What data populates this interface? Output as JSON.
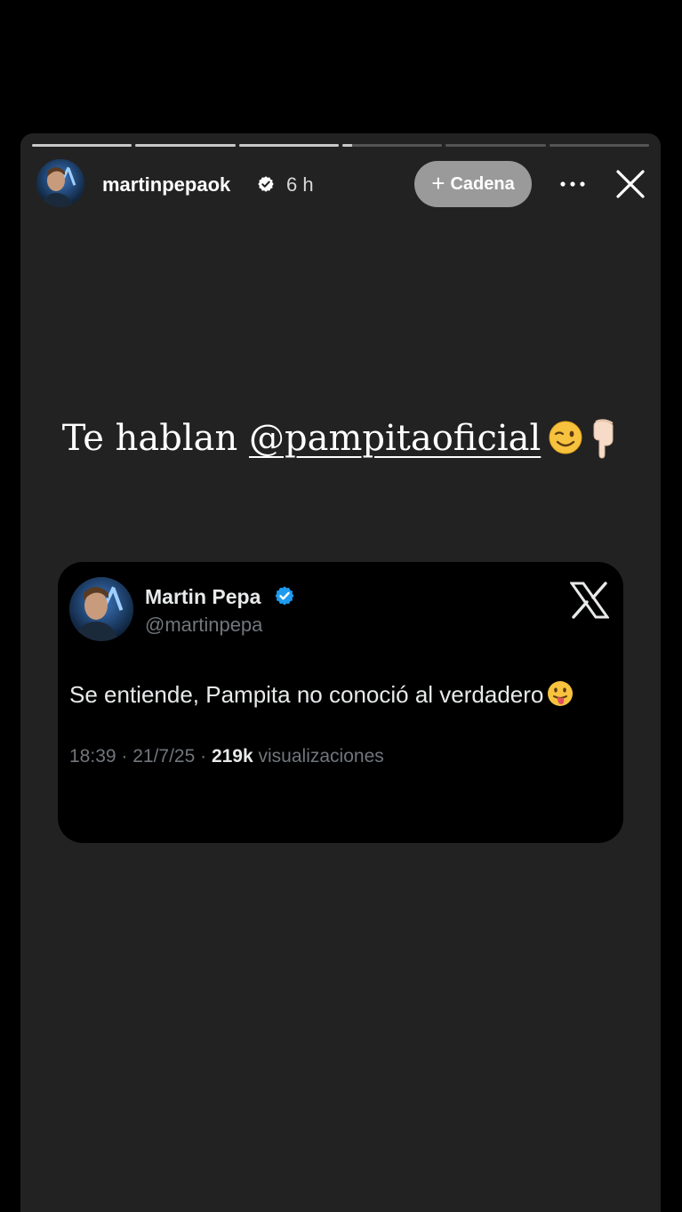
{
  "story": {
    "segments": [
      {
        "fill": 1.0
      },
      {
        "fill": 1.0
      },
      {
        "fill": 1.0
      },
      {
        "fill": 0.1
      },
      {
        "fill": 0.0
      },
      {
        "fill": 0.0
      }
    ],
    "header": {
      "username": "martinpepaok",
      "time": "6 h",
      "chain_button": {
        "icon": "+",
        "label": "Cadena"
      },
      "more_icon": "ellipsis-icon",
      "close_icon": "close-icon"
    },
    "caption": {
      "prefix": "Te hablan ",
      "mention": "@pampitaoficial",
      "emojis": [
        "winking-face-emoji",
        "pointing-down-emoji"
      ]
    },
    "tweet": {
      "name": "Martin Pepa",
      "handle": "@martinpepa",
      "text": "Se entiende, Pampita no conoció al verdadero",
      "emoji": "tongue-face-emoji",
      "time_date": "18:39 · 21/7/25 · ",
      "views_count": "219k",
      "views_label": " visualizaciones",
      "logo": "x-logo-icon"
    },
    "colors": {
      "story_bg": "#222222",
      "tweet_bg": "#000000",
      "verified_blue": "#1d9bf0",
      "button_gray": "#9a9a9a"
    }
  }
}
